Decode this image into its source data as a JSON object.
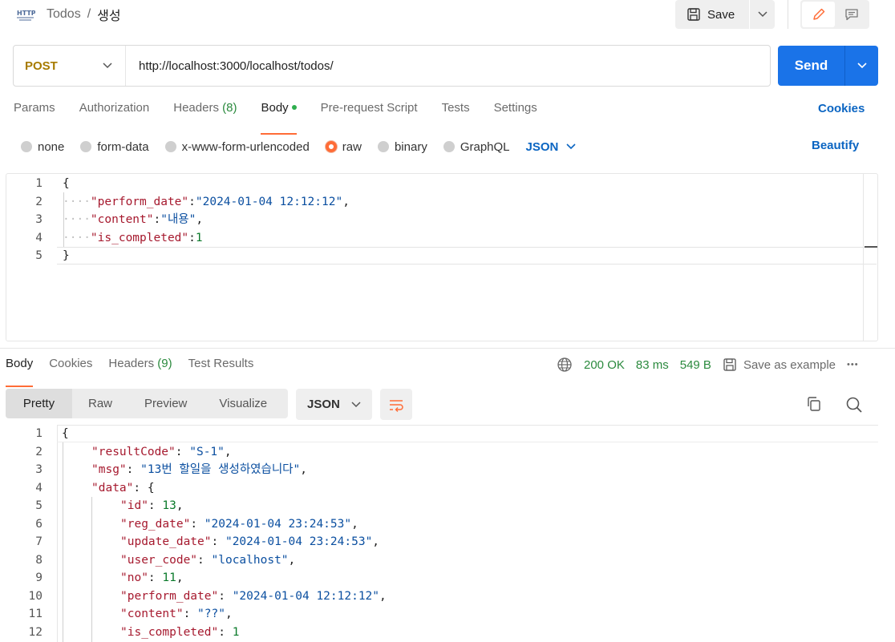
{
  "header": {
    "icon": "http-icon",
    "http_label": "HTTP",
    "collection": "Todos",
    "separator": "/",
    "request_name": "생성",
    "save_label": "Save"
  },
  "request": {
    "method": "POST",
    "url": "http://localhost:3000/localhost/todos/",
    "send_label": "Send"
  },
  "request_tabs": {
    "params": "Params",
    "authorization": "Authorization",
    "headers": "Headers",
    "headers_count": "(8)",
    "body": "Body",
    "prerequest": "Pre-request Script",
    "tests": "Tests",
    "settings": "Settings",
    "cookies": "Cookies"
  },
  "body_options": {
    "none": "none",
    "form_data": "form-data",
    "urlencoded": "x-www-form-urlencoded",
    "raw": "raw",
    "binary": "binary",
    "graphql": "GraphQL",
    "format": "JSON",
    "beautify": "Beautify",
    "selected": "raw"
  },
  "request_body": {
    "line_numbers": [
      "1",
      "2",
      "3",
      "4",
      "5"
    ],
    "lines": [
      {
        "punct": "{"
      },
      {
        "key": "\"perform_date\"",
        "colon": ":",
        "str": "\"2024-01-04 12:12:12\"",
        "tail": ","
      },
      {
        "key": "\"content\"",
        "colon": ":",
        "str": "\"내용\"",
        "tail": ","
      },
      {
        "key": "\"is_completed\"",
        "colon": ":",
        "num": "1"
      },
      {
        "punct": "}"
      }
    ]
  },
  "response_tabs": {
    "body": "Body",
    "cookies": "Cookies",
    "headers": "Headers",
    "headers_count": "(9)",
    "test_results": "Test Results"
  },
  "response_meta": {
    "status": "200 OK",
    "time": "83 ms",
    "size": "549 B",
    "save_example": "Save as example",
    "more": "•••"
  },
  "response_view": {
    "pretty": "Pretty",
    "raw": "Raw",
    "preview": "Preview",
    "visualize": "Visualize",
    "format": "JSON"
  },
  "response_body": {
    "line_numbers": [
      "1",
      "2",
      "3",
      "4",
      "5",
      "6",
      "7",
      "8",
      "9",
      "10",
      "11",
      "12"
    ],
    "l1": "{",
    "l2_key": "\"resultCode\"",
    "l2_str": "\"S-1\"",
    "l3_key": "\"msg\"",
    "l3_str": "\"13번 할일을 생성하였습니다\"",
    "l4_key": "\"data\"",
    "l4_brace": "{",
    "l5_key": "\"id\"",
    "l5_num": "13",
    "l6_key": "\"reg_date\"",
    "l6_str": "\"2024-01-04 23:24:53\"",
    "l7_key": "\"update_date\"",
    "l7_str": "\"2024-01-04 23:24:53\"",
    "l8_key": "\"user_code\"",
    "l8_str": "\"localhost\"",
    "l9_key": "\"no\"",
    "l9_num": "11",
    "l10_key": "\"perform_date\"",
    "l10_str": "\"2024-01-04 12:12:12\"",
    "l11_key": "\"content\"",
    "l11_str": "\"??\"",
    "l12_key": "\"is_completed\"",
    "l12_num": "1"
  },
  "colors": {
    "accent": "#ff6c37",
    "send": "#1a73e8",
    "method": "#a77b00",
    "link": "#0b65c2"
  }
}
